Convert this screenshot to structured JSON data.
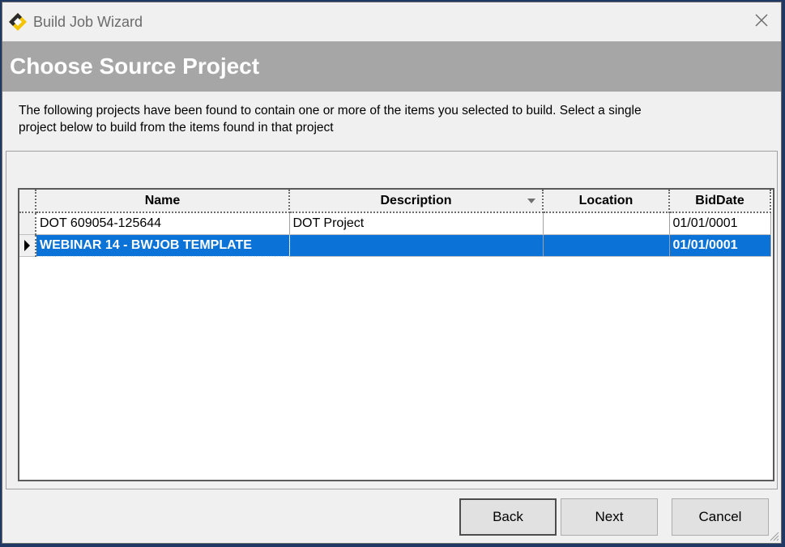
{
  "window": {
    "title": "Build Job Wizard",
    "close_glyph": "✕"
  },
  "header": {
    "title": "Choose Source Project"
  },
  "instructions": {
    "line1": "The following projects  have been found to contain one or more of the items you selected to build. Select a single",
    "line2": "project below to build  from the items found in that project"
  },
  "grid": {
    "columns": [
      "Name",
      "Description",
      "Location",
      "BidDate"
    ],
    "sorted_column": "Description",
    "rows": [
      {
        "name": "DOT 609054-125644",
        "description": "DOT Project",
        "location": "",
        "bid_date": "01/01/0001",
        "selected": false
      },
      {
        "name": "WEBINAR 14 - BWJOB TEMPLATE",
        "description": "",
        "location": "",
        "bid_date": "01/01/0001",
        "selected": true
      }
    ],
    "selection_color": "#0b73d8"
  },
  "buttons": {
    "back": "Back",
    "next": "Next",
    "cancel": "Cancel"
  },
  "icons": {
    "app": "build-job-wizard-logo-icon",
    "close": "close-icon",
    "row_pointer": "current-row-pointer-icon",
    "sort": "sort-dropdown-icon",
    "grip": "resize-grip-icon"
  }
}
